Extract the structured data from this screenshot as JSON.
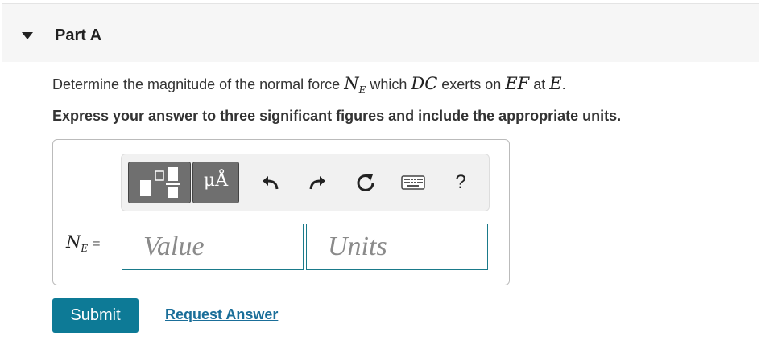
{
  "part": {
    "title": "Part A"
  },
  "question": {
    "prefix": "Determine the magnitude of the normal force ",
    "force_symbol": "N",
    "force_subscript": "E",
    "mid1": " which ",
    "member1": "DC",
    "mid2": " exerts on ",
    "member2": "EF",
    "mid3": " at ",
    "point": "E",
    "suffix": "."
  },
  "instruction": "Express your answer to three significant figures and include the appropriate units.",
  "toolbar": {
    "units_label": "μÅ",
    "help_label": "?",
    "icons": [
      "templates-icon",
      "units-icon",
      "undo-icon",
      "redo-icon",
      "reset-icon",
      "keyboard-icon",
      "help-icon"
    ]
  },
  "answer": {
    "label_symbol": "N",
    "label_subscript": "E",
    "equals": "=",
    "value_placeholder": "Value",
    "units_placeholder": "Units"
  },
  "actions": {
    "submit_label": "Submit",
    "request_label": "Request Answer"
  },
  "colors": {
    "accent": "#0d7a96",
    "link": "#1a6e99",
    "header_bg": "#f6f6f6",
    "tool_button": "#6f6f6f"
  }
}
